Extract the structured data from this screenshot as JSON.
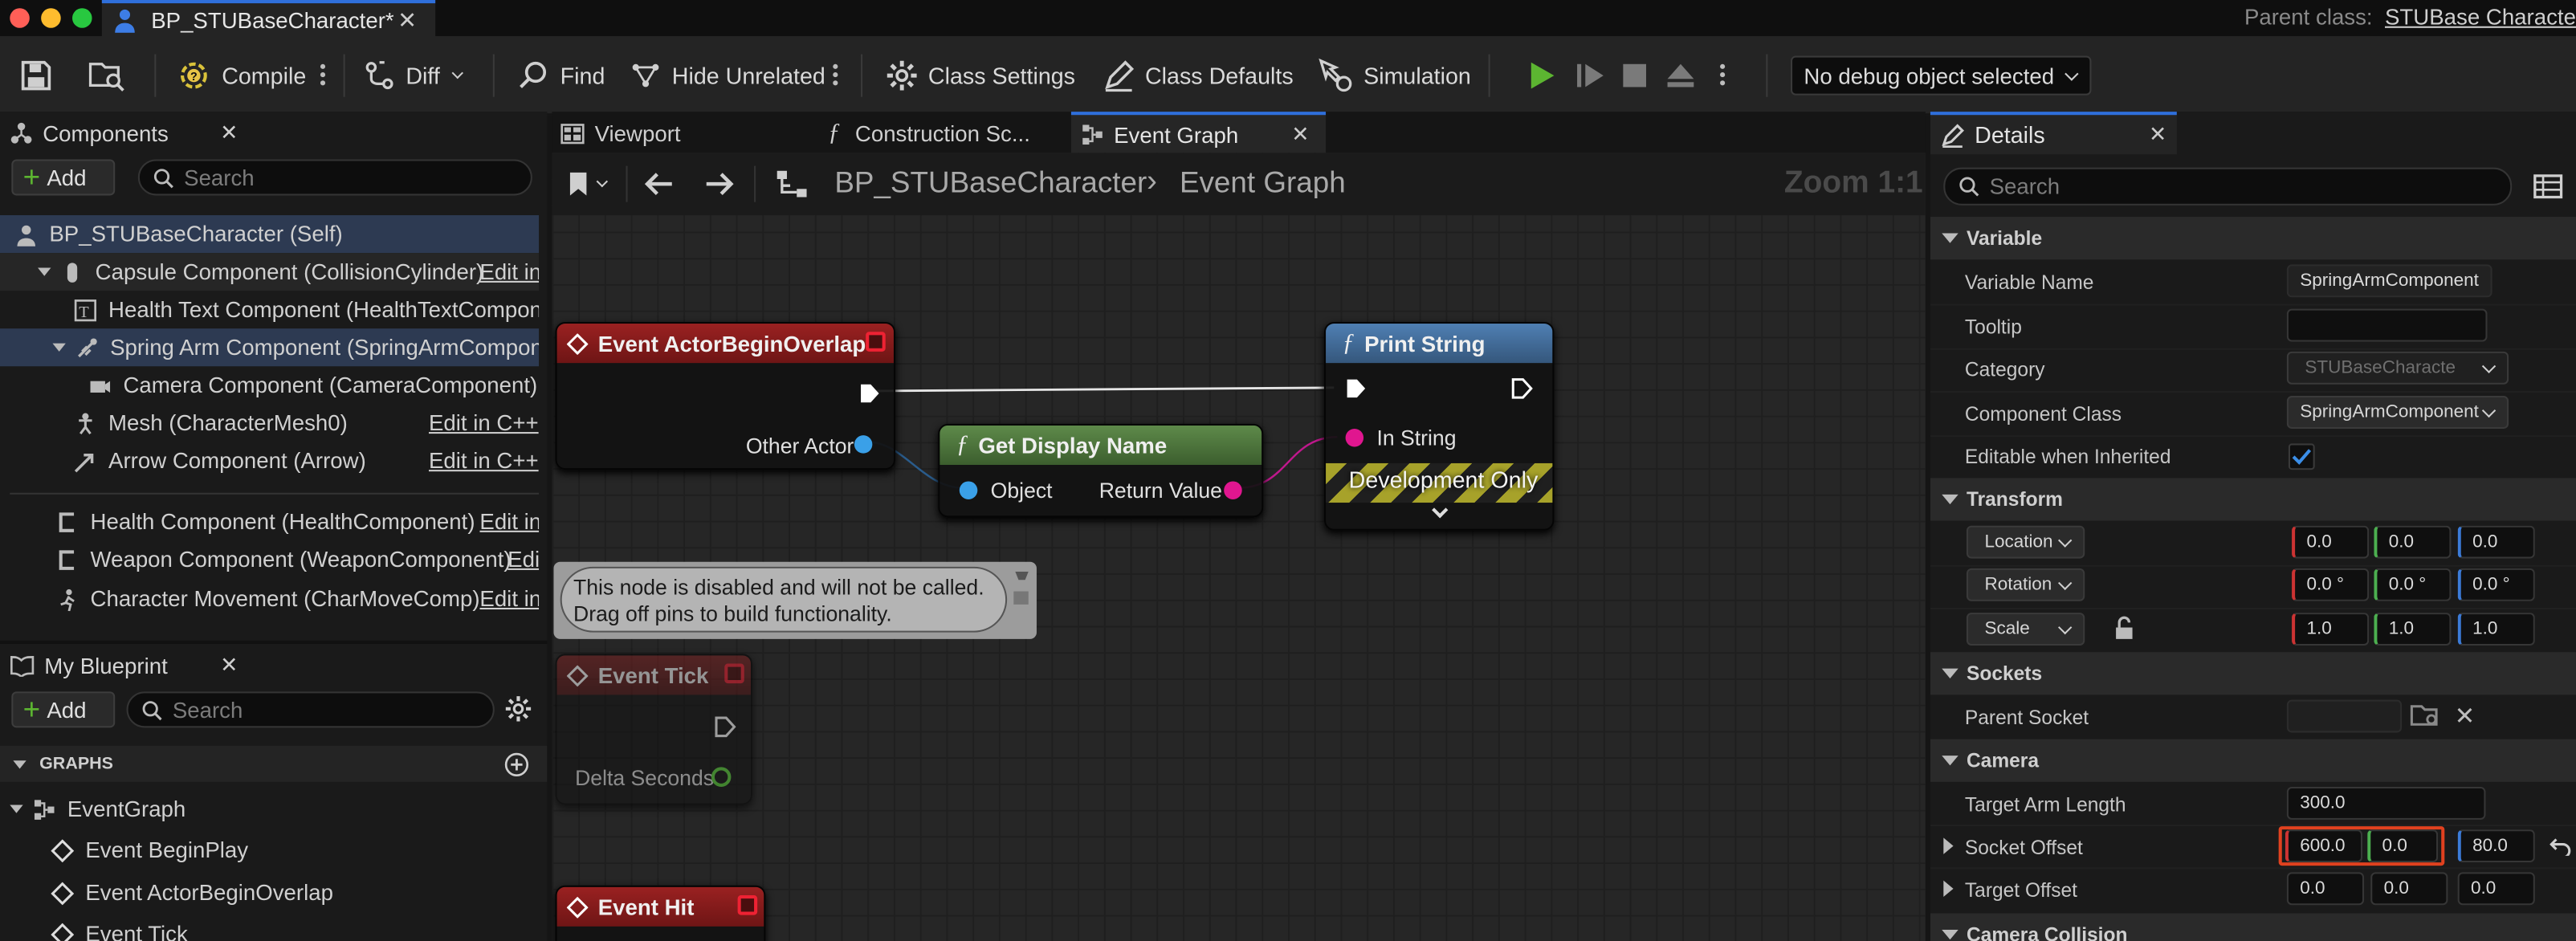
{
  "window": {
    "tab_title": "BP_STUBaseCharacter*",
    "parent_class_label": "Parent class:",
    "parent_class_value": "STUBase Characte"
  },
  "toolbar": {
    "compile": "Compile",
    "diff": "Diff",
    "find": "Find",
    "hide_unrelated": "Hide Unrelated",
    "class_settings": "Class Settings",
    "class_defaults": "Class Defaults",
    "simulation": "Simulation",
    "debug_object": "No debug object selected"
  },
  "components": {
    "tab": "Components",
    "add": "Add",
    "search_placeholder": "Search",
    "items": [
      {
        "label": "BP_STUBaseCharacter (Self)",
        "edit": ""
      },
      {
        "label": "Capsule Component (CollisionCylinder)",
        "edit": "Edit in"
      },
      {
        "label": "Health Text Component (HealthTextComponent)",
        "edit": ""
      },
      {
        "label": "Spring Arm Component (SpringArmComponent)",
        "edit": ""
      },
      {
        "label": "Camera Component (CameraComponent)",
        "edit": ""
      },
      {
        "label": "Mesh (CharacterMesh0)",
        "edit": "Edit in C++"
      },
      {
        "label": "Arrow Component (Arrow)",
        "edit": "Edit in C++"
      },
      {
        "label": "Health Component (HealthComponent)",
        "edit": "Edit in"
      },
      {
        "label": "Weapon Component (WeaponComponent)",
        "edit": "Edi"
      },
      {
        "label": "Character Movement (CharMoveComp)",
        "edit": "Edit in"
      }
    ]
  },
  "my_blueprint": {
    "tab": "My Blueprint",
    "add": "Add",
    "search_placeholder": "Search",
    "graphs_header": "GRAPHS",
    "items": [
      "EventGraph",
      "Event BeginPlay",
      "Event ActorBeginOverlap",
      "Event Tick"
    ]
  },
  "editor_tabs": {
    "viewport": "Viewport",
    "construction": "Construction Sc...",
    "event_graph": "Event Graph"
  },
  "graph": {
    "breadcrumb_root": "BP_STUBaseCharacter",
    "breadcrumb_current": "Event Graph",
    "zoom": "Zoom 1:1",
    "nodes": {
      "overlap": {
        "title": "Event ActorBeginOverlap",
        "pin_other_actor": "Other Actor"
      },
      "display_name": {
        "title": "Get Display Name",
        "pin_object": "Object",
        "pin_return": "Return Value"
      },
      "print_string": {
        "title": "Print String",
        "pin_in_string": "In String",
        "dev_only": "Development Only"
      },
      "comment": {
        "line1": "This node is disabled and will not be called.",
        "line2": "Drag off pins to build functionality."
      },
      "tick": {
        "title": "Event Tick",
        "pin_delta": "Delta Seconds"
      },
      "hit": {
        "title": "Event Hit"
      }
    }
  },
  "details": {
    "tab": "Details",
    "search_placeholder": "Search",
    "categories": {
      "variable": "Variable",
      "transform": "Transform",
      "sockets": "Sockets",
      "camera": "Camera",
      "camera_collision": "Camera Collision"
    },
    "variable": {
      "name_label": "Variable Name",
      "name_value": "SpringArmComponent",
      "tooltip_label": "Tooltip",
      "category_label": "Category",
      "category_value": "STUBaseCharacte",
      "class_label": "Component Class",
      "class_value": "SpringArmComponent",
      "editable_label": "Editable when Inherited",
      "editable_checked": true
    },
    "transform": {
      "location": {
        "label": "Location",
        "x": "0.0",
        "y": "0.0",
        "z": "0.0"
      },
      "rotation": {
        "label": "Rotation",
        "x": "0.0 °",
        "y": "0.0 °",
        "z": "0.0 °"
      },
      "scale": {
        "label": "Scale",
        "x": "1.0",
        "y": "1.0",
        "z": "1.0"
      }
    },
    "sockets": {
      "parent_label": "Parent Socket",
      "parent_value": ""
    },
    "camera": {
      "target_arm_length_label": "Target Arm Length",
      "target_arm_length": "300.0",
      "socket_offset_label": "Socket Offset",
      "socket_offset": {
        "x": "600.0",
        "y": "0.0",
        "z": "80.0"
      },
      "target_offset_label": "Target Offset",
      "target_offset": {
        "x": "0.0",
        "y": "0.0",
        "z": "0.0"
      }
    }
  },
  "colors": {
    "accent_blue": "#2f6fdb",
    "event_red": "#8b1c1c",
    "pure_green": "#4e7a3d",
    "function_blue": "#3f6d9e",
    "highlight_orange": "#e0411f",
    "play_green": "#5cb531"
  }
}
